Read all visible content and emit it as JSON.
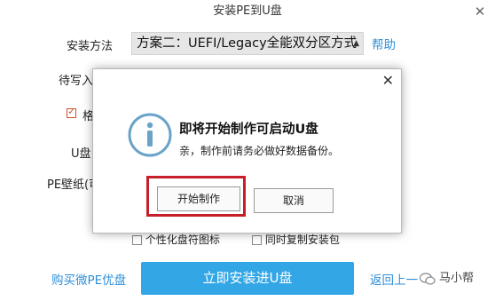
{
  "window": {
    "title": "安装PE到U盘",
    "close_glyph": "✕"
  },
  "form": {
    "method_label": "安装方法",
    "method_value": "方案二：UEFI/Legacy全能双分区方式",
    "help_label": "帮助",
    "pending_label": "待写入",
    "format_label": "格",
    "udisk_label": "U盘",
    "wallpaper_label": "PE壁纸(可",
    "option_personalize": "个性化盘符图标",
    "option_copy": "同时复制安装包"
  },
  "footer": {
    "buy_link": "购买微PE优盘",
    "install_button": "立即安装进U盘",
    "back_link": "返回上一"
  },
  "watermark": {
    "text": "马小帮"
  },
  "dialog": {
    "close_glyph": "✕",
    "title": "即将开始制作可启动U盘",
    "message": "亲，制作前请务必做好数据备份。",
    "start_button": "开始制作",
    "cancel_button": "取消",
    "icon": "info-icon"
  },
  "colors": {
    "accent": "#33a6e6",
    "link": "#2f8fd8",
    "highlight_outline": "#c61f2a",
    "info_icon": "#6aa3c8"
  }
}
